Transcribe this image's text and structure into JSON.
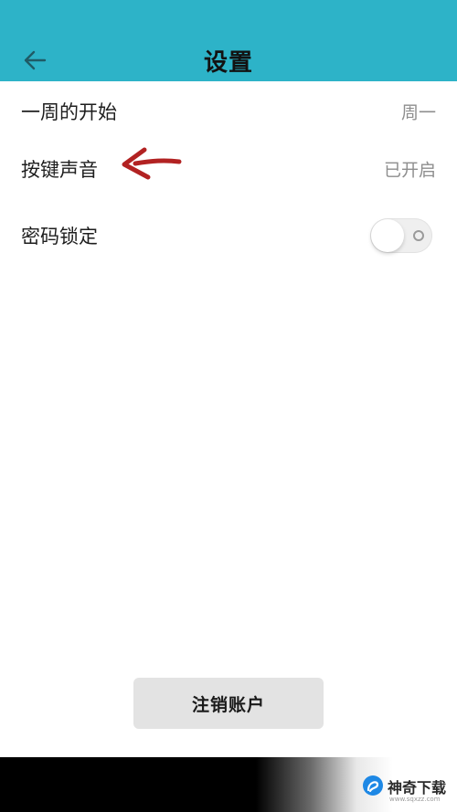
{
  "header": {
    "title": "设置",
    "back_icon": "arrow-left-icon",
    "color": "#2db3c8"
  },
  "settings": [
    {
      "label": "一周的开始",
      "value": "周一"
    },
    {
      "label": "按键声音",
      "value": "已开启"
    },
    {
      "label": "密码锁定",
      "toggle": false
    }
  ],
  "annotation": {
    "icon": "red-arrow-icon",
    "color": "#b22222"
  },
  "logout_button": {
    "label": "注销账户"
  },
  "watermark": {
    "name": "神奇下载",
    "url": "www.sqxzz.com"
  }
}
